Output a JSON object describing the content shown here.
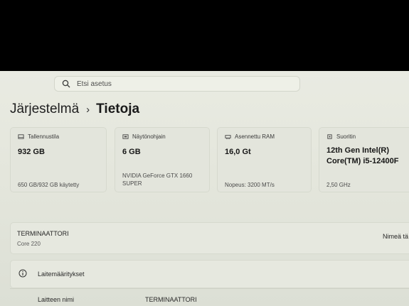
{
  "search": {
    "placeholder": "Etsi asetus"
  },
  "breadcrumb": {
    "parent": "Järjestelmä",
    "separator": "›",
    "current": "Tietoja"
  },
  "cards": [
    {
      "title": "Tallennustila",
      "icon": "storage-icon",
      "value": "932 GB",
      "sub": "650 GB/932 GB käytetty"
    },
    {
      "title": "Näytönohjain",
      "icon": "gpu-icon",
      "value": "6 GB",
      "sub": "NVIDIA GeForce GTX 1660 SUPER"
    },
    {
      "title": "Asennettu RAM",
      "icon": "ram-icon",
      "value": "16,0 Gt",
      "sub": "Nopeus: 3200 MT/s"
    },
    {
      "title": "Suoritin",
      "icon": "cpu-icon",
      "value": "12th Gen Intel(R) Core(TM) i5-12400F",
      "sub": "2,50 GHz"
    }
  ],
  "device": {
    "name": "TERMINAATTORI",
    "model": "Core 220",
    "rename_label": "Nimeä tä"
  },
  "specs": {
    "section_title": "Laitemääritykset",
    "device_name_label": "Laitteen nimi",
    "device_name_value": "TERMINAATTORI"
  },
  "colors": {
    "background": "#e6e8df",
    "bezel": "#000000",
    "card": "#e3e5dc"
  }
}
